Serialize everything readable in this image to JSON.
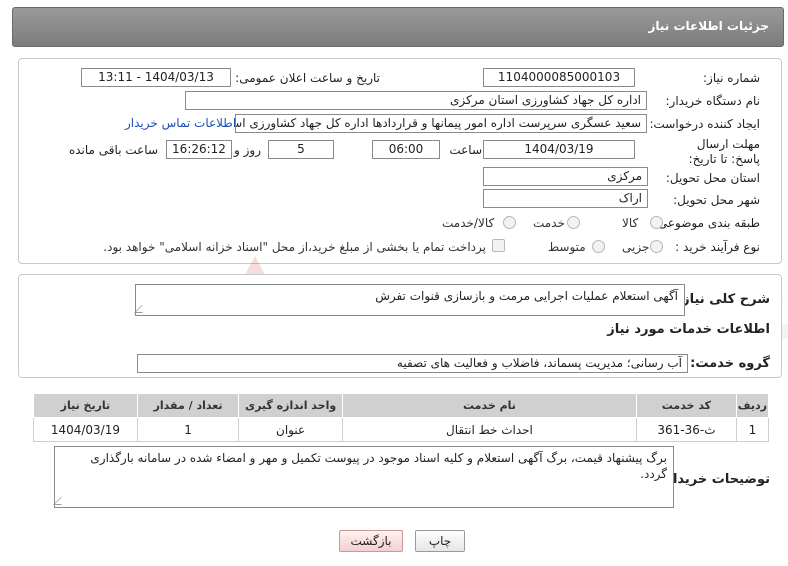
{
  "header": {
    "title": "جزئیات اطلاعات نیاز"
  },
  "form": {
    "need_number_label": "شماره نیاز:",
    "need_number": "1104000085000103",
    "announce_label": "تاریخ و ساعت اعلان عمومی:",
    "announce_value": "1404/03/13 - 13:11",
    "buyer_org_label": "نام دستگاه خریدار:",
    "buyer_org": "اداره کل جهاد کشاورزی استان مرکزی",
    "requester_label": "ایجاد کننده درخواست:",
    "requester": "سعید عسگری سرپرست اداره امور پیمانها و قراردادها اداره کل جهاد کشاورزی استان مرکزی",
    "contact_link": "اطلاعات تماس خریدار",
    "deadline_label": "مهلت ارسال پاسخ: تا تاریخ:",
    "deadline_date": "1404/03/19",
    "time_label": "ساعت",
    "deadline_time": "06:00",
    "days_value": "5",
    "days_label": "روز و",
    "remaining_time": "16:26:12",
    "remaining_label": "ساعت باقی مانده",
    "province_label": "استان محل تحویل:",
    "province": "مرکزی",
    "city_label": "شهر محل تحویل:",
    "city": "اراک",
    "category_label": "طبقه بندی موضوعی:",
    "category_options": [
      "کالا",
      "خدمت",
      "کالا/خدمت"
    ],
    "process_label": "نوع فرآیند خرید :",
    "process_options": [
      "جزیی",
      "متوسط"
    ],
    "payment_note": "پرداخت تمام یا بخشی از مبلغ خرید،از محل \"اسناد خزانه اسلامی\" خواهد بود."
  },
  "summary": {
    "label": "شرح کلی نیاز:",
    "value": "آگهی استعلام عملیات اجرایی مرمت و بازسازی قنوات تفرش"
  },
  "services": {
    "section_title": "اطلاعات خدمات مورد نیاز",
    "group_label": "گروه خدمت:",
    "group_value": "آب رسانی؛ مدیریت پسماند، فاضلاب و فعالیت های تصفیه",
    "table": {
      "headers": [
        "ردیف",
        "کد خدمت",
        "نام خدمت",
        "واحد اندازه گیری",
        "تعداد / مقدار",
        "تاریخ نیاز"
      ],
      "rows": [
        [
          "1",
          "ث-36-361",
          "احداث خط انتقال",
          "عنوان",
          "1",
          "1404/03/19"
        ]
      ]
    }
  },
  "buyer_notes": {
    "label": "توضیحات خریدار:",
    "value": "برگ پیشنهاد قیمت، برگ آگهی استعلام و  کلیه اسناد موجود در پیوست تکمیل و مهر و امضاء شده در سامانه بارگذاری گردد."
  },
  "buttons": {
    "print": "چاپ",
    "back": "بازگشت"
  },
  "watermark": {
    "text": "AriaTender.net"
  }
}
